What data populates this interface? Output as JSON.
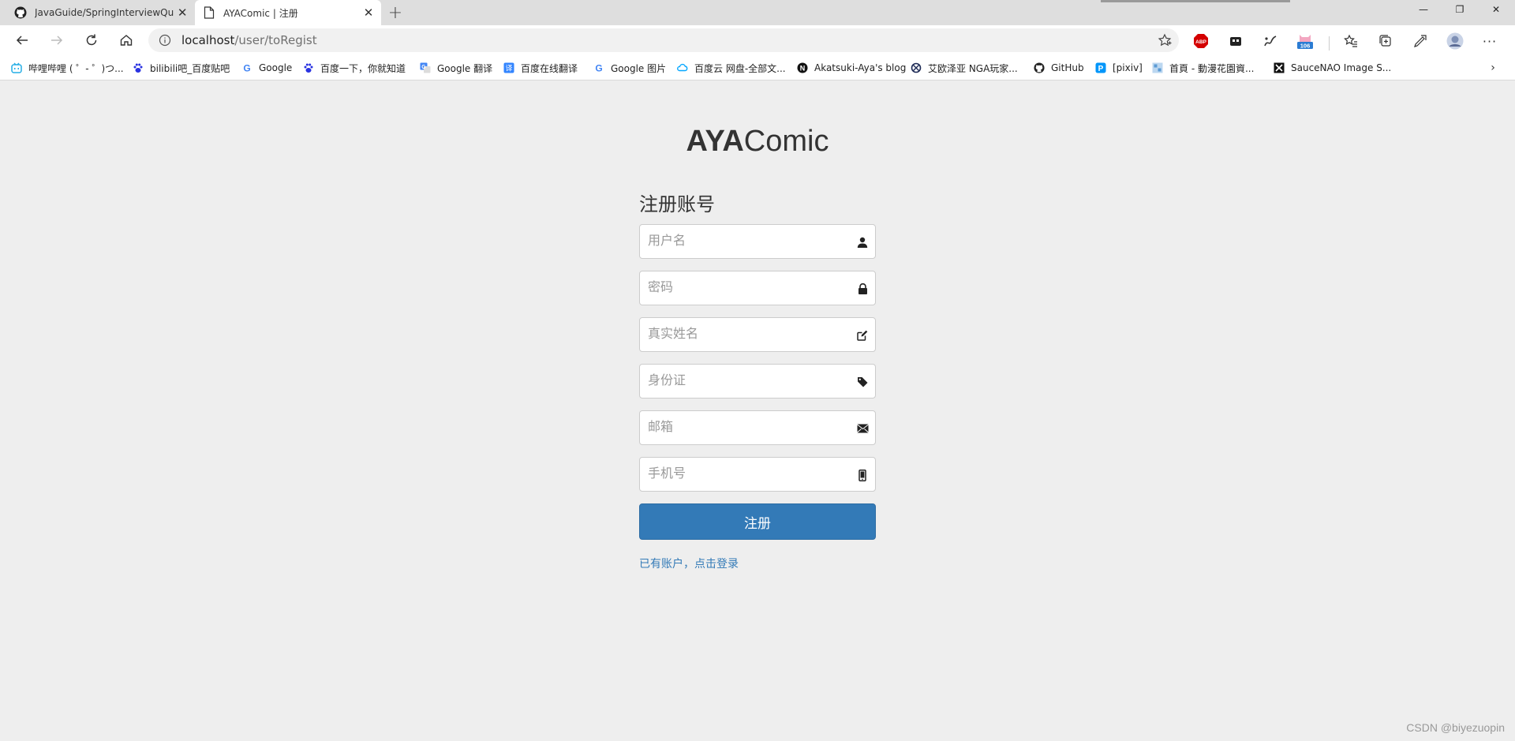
{
  "browser": {
    "tabs": [
      {
        "title": "JavaGuide/SpringInterviewQuest",
        "icon": "github-icon",
        "active": false
      },
      {
        "title": "AYAComic | 注册",
        "icon": "page-icon",
        "active": true
      }
    ],
    "window_controls": {
      "minimize": "—",
      "restore": "❐",
      "close": "✕"
    },
    "address": {
      "host": "localhost",
      "path": "/user/toRegist"
    },
    "extensions": {
      "abp_label": "ABP",
      "badge_count": "106"
    },
    "more_label": "···",
    "bookmarks": [
      {
        "label": "哔哩哔哩 ( ゜- ゜)つ...",
        "icon": "bilibili-icon"
      },
      {
        "label": "bilibili吧_百度贴吧",
        "icon": "baidu-paw-icon"
      },
      {
        "label": "Google",
        "icon": "google-icon"
      },
      {
        "label": "百度一下，你就知道",
        "icon": "baidu-paw-icon"
      },
      {
        "label": "Google 翻译",
        "icon": "google-translate-icon"
      },
      {
        "label": "百度在线翻译",
        "icon": "baidu-translate-icon"
      },
      {
        "label": "Google 图片",
        "icon": "google-icon"
      },
      {
        "label": "百度云 网盘-全部文...",
        "icon": "baidu-cloud-icon"
      },
      {
        "label": "Akatsuki-Aya's blog",
        "icon": "notion-icon"
      },
      {
        "label": "艾欧泽亚 NGA玩家...",
        "icon": "nga-icon"
      },
      {
        "label": "GitHub",
        "icon": "github-icon"
      },
      {
        "label": "[pixiv]",
        "icon": "pixiv-icon"
      },
      {
        "label": "首頁 - 動漫花園資...",
        "icon": "dmhy-icon"
      },
      {
        "label": "SauceNAO Image S...",
        "icon": "saucenao-icon"
      }
    ],
    "bookmarks_overflow": "›"
  },
  "page": {
    "brand_bold": "AYA",
    "brand_light": "Comic",
    "heading": "注册账号",
    "fields": [
      {
        "placeholder": "用户名",
        "value": "",
        "icon": "user-icon"
      },
      {
        "placeholder": "密码",
        "value": "",
        "icon": "lock-icon"
      },
      {
        "placeholder": "真实姓名",
        "value": "",
        "icon": "edit-icon"
      },
      {
        "placeholder": "身份证",
        "value": "",
        "icon": "tag-icon"
      },
      {
        "placeholder": "邮箱",
        "value": "",
        "icon": "envelope-icon"
      },
      {
        "placeholder": "手机号",
        "value": "",
        "icon": "phone-icon"
      }
    ],
    "submit_label": "注册",
    "login_link": "已有账户，点击登录"
  },
  "watermark": "CSDN @biyezuopin",
  "colors": {
    "primary": "#337ab7",
    "page_bg": "#eeeeee",
    "titlebar_bg": "#dedede"
  }
}
